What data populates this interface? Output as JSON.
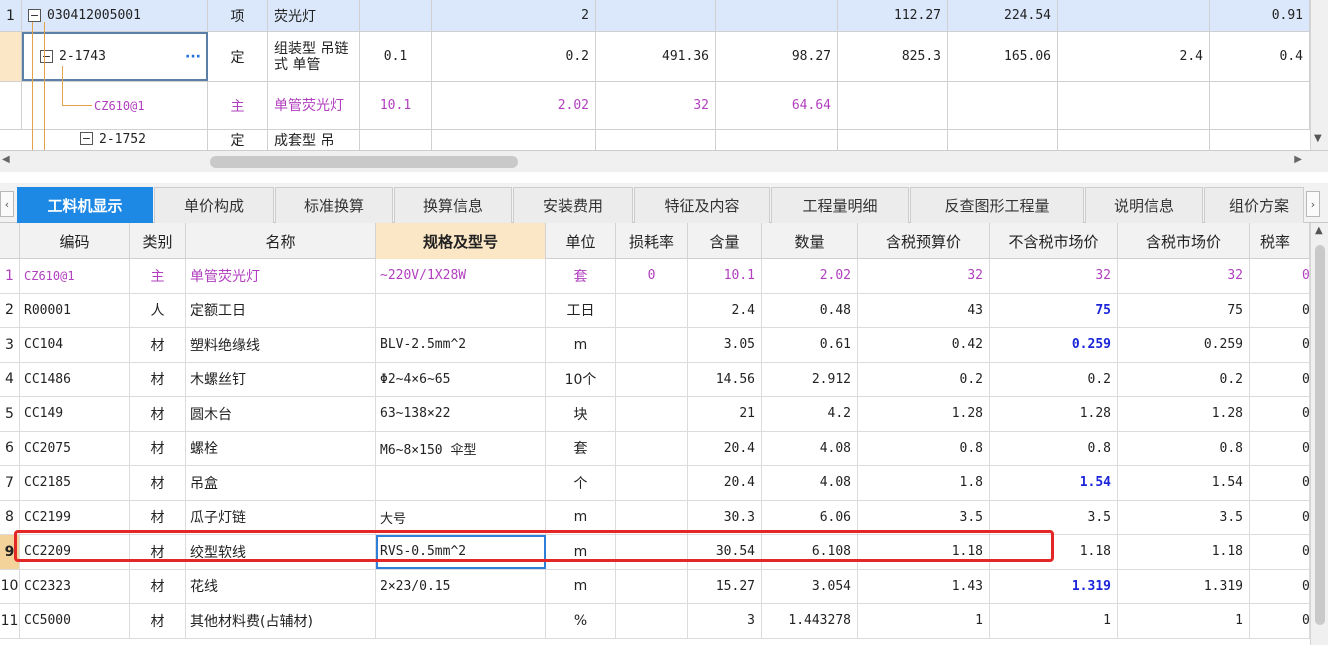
{
  "top_rows": [
    {
      "rownum": "1",
      "code": "030412005001",
      "type": "项",
      "name": "荧光灯",
      "c1": "",
      "c2": "2",
      "c3": "",
      "c4": "",
      "c5": "112.27",
      "c6": "224.54",
      "c7": "",
      "c8": "0.91"
    },
    {
      "rownum": "",
      "code": "2-1743",
      "more": "···",
      "type": "定",
      "name": "组装型 吊链式 单管",
      "c1": "0.1",
      "c2": "0.2",
      "c3": "491.36",
      "c4": "98.27",
      "c5": "825.3",
      "c6": "165.06",
      "c7": "2.4",
      "c8": "0.4"
    },
    {
      "rownum": "",
      "code": "CZ610@1",
      "type": "主",
      "name": "单管荧光灯",
      "c1": "10.1",
      "c2": "2.02",
      "c3": "32",
      "c4": "64.64",
      "c5": "",
      "c6": "",
      "c7": "",
      "c8": ""
    },
    {
      "rownum": "",
      "code": "2-1752",
      "type": "定",
      "name": "成套型 吊",
      "c1": "",
      "c2": "",
      "c3": "",
      "c4": "",
      "c5": "",
      "c6": "",
      "c7": "",
      "c8": ""
    }
  ],
  "tabs": [
    "工料机显示",
    "单价构成",
    "标准换算",
    "换算信息",
    "安装费用",
    "特征及内容",
    "工程量明细",
    "反查图形工程量",
    "说明信息",
    "组价方案"
  ],
  "active_tab": 0,
  "columns": [
    "编码",
    "类别",
    "名称",
    "规格及型号",
    "单位",
    "损耗率",
    "含量",
    "数量",
    "含税预算价",
    "不含税市场价",
    "含税市场价",
    "税率"
  ],
  "rows": [
    {
      "n": "1",
      "code": "CZ610@1",
      "cat": "主",
      "name": "单管荧光灯",
      "spec": "~220V/1X28W",
      "unit": "套",
      "loss": "0",
      "qty": "10.1",
      "amount": "2.02",
      "budget": "32",
      "market_ex": "32",
      "market_in": "32",
      "tax": "0",
      "purple": true
    },
    {
      "n": "2",
      "code": "R00001",
      "cat": "人",
      "name": "定额工日",
      "spec": "",
      "unit": "工日",
      "loss": "",
      "qty": "2.4",
      "amount": "0.48",
      "budget": "43",
      "market_ex": "75",
      "market_in": "75",
      "tax": "0",
      "blue": true
    },
    {
      "n": "3",
      "code": "CC104",
      "cat": "材",
      "name": "塑料绝缘线",
      "spec": "BLV-2.5mm^2",
      "unit": "m",
      "loss": "",
      "qty": "3.05",
      "amount": "0.61",
      "budget": "0.42",
      "market_ex": "0.259",
      "market_in": "0.259",
      "tax": "0",
      "blue": true
    },
    {
      "n": "4",
      "code": "CC1486",
      "cat": "材",
      "name": "木螺丝钉",
      "spec": "Φ2~4×6~65",
      "unit": "10个",
      "loss": "",
      "qty": "14.56",
      "amount": "2.912",
      "budget": "0.2",
      "market_ex": "0.2",
      "market_in": "0.2",
      "tax": "0"
    },
    {
      "n": "5",
      "code": "CC149",
      "cat": "材",
      "name": "圆木台",
      "spec": "63~138×22",
      "unit": "块",
      "loss": "",
      "qty": "21",
      "amount": "4.2",
      "budget": "1.28",
      "market_ex": "1.28",
      "market_in": "1.28",
      "tax": "0"
    },
    {
      "n": "6",
      "code": "CC2075",
      "cat": "材",
      "name": "螺栓",
      "spec": "M6~8×150 伞型",
      "unit": "套",
      "loss": "",
      "qty": "20.4",
      "amount": "4.08",
      "budget": "0.8",
      "market_ex": "0.8",
      "market_in": "0.8",
      "tax": "0"
    },
    {
      "n": "7",
      "code": "CC2185",
      "cat": "材",
      "name": "吊盒",
      "spec": "",
      "unit": "个",
      "loss": "",
      "qty": "20.4",
      "amount": "4.08",
      "budget": "1.8",
      "market_ex": "1.54",
      "market_in": "1.54",
      "tax": "0",
      "blue": true
    },
    {
      "n": "8",
      "code": "CC2199",
      "cat": "材",
      "name": "瓜子灯链",
      "spec": "大号",
      "unit": "m",
      "loss": "",
      "qty": "30.3",
      "amount": "6.06",
      "budget": "3.5",
      "market_ex": "3.5",
      "market_in": "3.5",
      "tax": "0"
    },
    {
      "n": "9",
      "code": "CC2209",
      "cat": "材",
      "name": "绞型软线",
      "spec": "RVS-0.5mm^2",
      "unit": "m",
      "loss": "",
      "qty": "30.54",
      "amount": "6.108",
      "budget": "1.18",
      "market_ex": "1.18",
      "market_in": "1.18",
      "tax": "0",
      "selected": true
    },
    {
      "n": "10",
      "code": "CC2323",
      "cat": "材",
      "name": "花线",
      "spec": "2×23/0.15",
      "unit": "m",
      "loss": "",
      "qty": "15.27",
      "amount": "3.054",
      "budget": "1.43",
      "market_ex": "1.319",
      "market_in": "1.319",
      "tax": "0",
      "blue": true
    },
    {
      "n": "11",
      "code": "CC5000",
      "cat": "材",
      "name": "其他材料费(占辅材)",
      "spec": "",
      "unit": "%",
      "loss": "",
      "qty": "3",
      "amount": "1.443278",
      "budget": "1",
      "market_ex": "1",
      "market_in": "1",
      "tax": "0"
    }
  ]
}
